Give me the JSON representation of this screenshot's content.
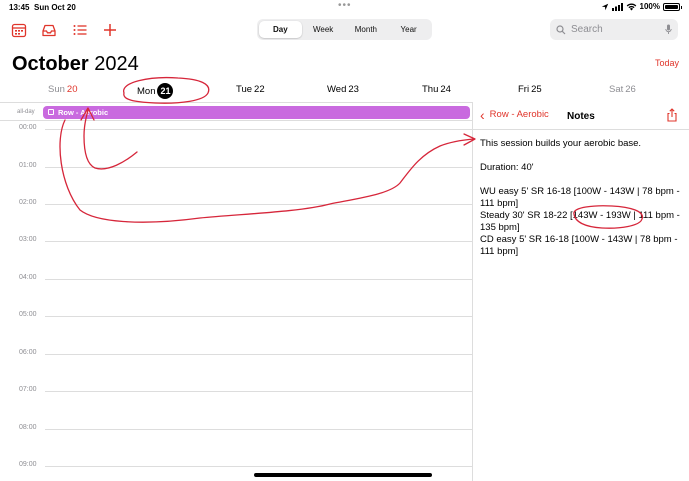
{
  "status": {
    "time": "13:45",
    "date": "Sun Oct 20",
    "battery": "100%",
    "battery_level": 1.0
  },
  "toolbar": {
    "icons": [
      "calendar-icon",
      "inbox-icon",
      "list-icon",
      "add-icon"
    ],
    "views": [
      {
        "label": "Day",
        "active": true
      },
      {
        "label": "Week",
        "active": false
      },
      {
        "label": "Month",
        "active": false
      },
      {
        "label": "Year",
        "active": false
      }
    ],
    "search_placeholder": "Search"
  },
  "header": {
    "month": "October",
    "year": "2024",
    "today_label": "Today"
  },
  "days": [
    {
      "name": "Sun",
      "num": "20",
      "style": "gray-red"
    },
    {
      "name": "Mon",
      "num": "21",
      "style": "selected"
    },
    {
      "name": "Tue",
      "num": "22",
      "style": "normal"
    },
    {
      "name": "Wed",
      "num": "23",
      "style": "normal"
    },
    {
      "name": "Thu",
      "num": "24",
      "style": "normal"
    },
    {
      "name": "Fri",
      "num": "25",
      "style": "normal"
    },
    {
      "name": "Sat",
      "num": "26",
      "style": "gray"
    }
  ],
  "allday": {
    "label": "all-day",
    "event_title": "Row - Aerobic",
    "event_color": "#c96adf"
  },
  "hours": [
    "00:00",
    "01:00",
    "02:00",
    "03:00",
    "04:00",
    "05:00",
    "06:00",
    "07:00",
    "08:00",
    "09:00"
  ],
  "panel": {
    "back_label": "Row - Aerobic",
    "title": "Notes",
    "notes": {
      "intro": "This session builds your aerobic base.",
      "duration": "Duration: 40'",
      "lines": [
        "WU easy 5' SR 16-18 [100W - 143W | 78 bpm - 111 bpm]",
        "Steady 30' SR 18-22 [143W - 193W | 111 bpm - 135 bpm]",
        "CD easy 5' SR 16-18 [100W - 143W | 78 bpm - 111 bpm]"
      ]
    }
  },
  "colors": {
    "accent": "#e0352b",
    "annotation": "#d6263a"
  }
}
